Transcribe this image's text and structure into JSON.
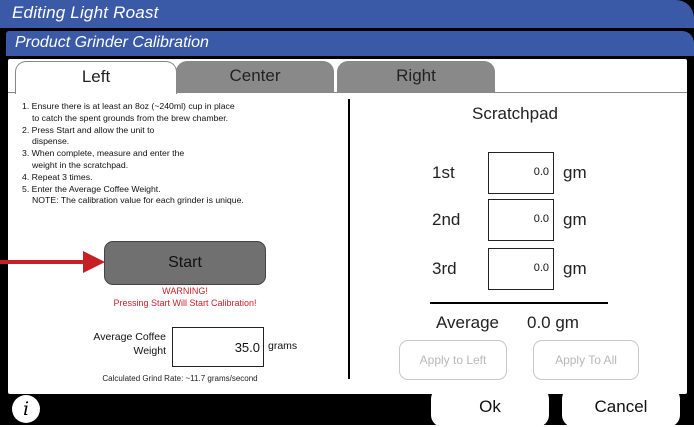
{
  "window": {
    "title": "Editing Light Roast",
    "subtitle": "Product Grinder Calibration"
  },
  "tabs": [
    {
      "label": "Left",
      "active": true
    },
    {
      "label": "Center",
      "active": false
    },
    {
      "label": "Right",
      "active": false
    }
  ],
  "instructions": [
    "1. Ensure there is at least an 8oz (~240ml) cup in place",
    "to catch the spent grounds from the brew chamber.",
    "2. Press Start and allow the unit to",
    "dispense.",
    "3. When complete, measure and enter the",
    "weight in the scratchpad.",
    "4. Repeat 3 times.",
    "5. Enter the Average Coffee Weight.",
    "NOTE:  The calibration value for each grinder is unique."
  ],
  "start": {
    "label": "Start",
    "warning_title": "WARNING!",
    "warning_text": "Pressing Start Will Start Calibration!"
  },
  "average_weight": {
    "label_line1": "Average Coffee",
    "label_line2": "Weight",
    "value": "35.0",
    "unit": "grams"
  },
  "calculated_rate": "Calculated Grind Rate: ~11.7 grams/second",
  "scratchpad": {
    "title": "Scratchpad",
    "rows": [
      {
        "label": "1st",
        "value": "0.0",
        "unit": "gm"
      },
      {
        "label": "2nd",
        "value": "0.0",
        "unit": "gm"
      },
      {
        "label": "3rd",
        "value": "0.0",
        "unit": "gm"
      }
    ],
    "average_label": "Average",
    "average_value": "0.0 gm",
    "apply_left_label": "Apply to Left",
    "apply_all_label": "Apply To All"
  },
  "footer": {
    "info_glyph": "i",
    "ok_label": "Ok",
    "cancel_label": "Cancel"
  },
  "colors": {
    "title_bar": "#3a5aa8",
    "inactive_tab": "#898989",
    "start_button": "#707070",
    "warning": "#d0202a",
    "arrow": "#c42026"
  },
  "icons": {
    "info": "info-icon",
    "arrow": "red-pointer-arrow"
  }
}
